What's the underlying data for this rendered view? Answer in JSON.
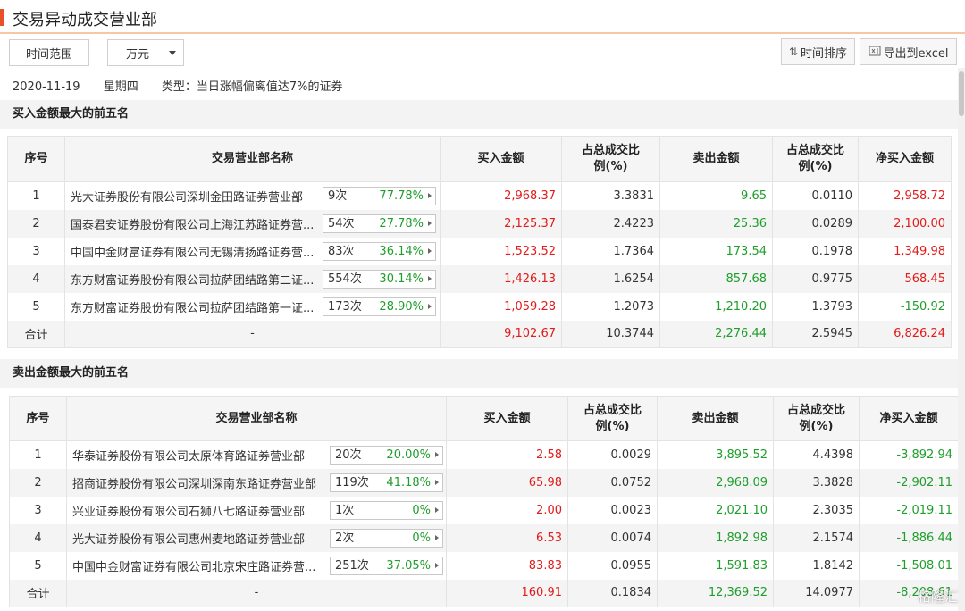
{
  "page": {
    "title": "交易异动成交营业部"
  },
  "toolbar": {
    "time_range": "时间范围",
    "unit": "万元",
    "sort_label": "时间排序",
    "export_label": "导出到excel"
  },
  "info": {
    "date": "2020-11-19",
    "weekday": "星期四",
    "type": "类型：当日涨幅偏离值达7%的证券"
  },
  "columns": [
    "序号",
    "交易营业部名称",
    "买入金额",
    "占总成交比例(%)",
    "卖出金额",
    "占总成交比例(%)",
    "净买入金额"
  ],
  "buy_section": {
    "title": "买入金额最大的前五名",
    "rows": [
      {
        "idx": "1",
        "name": "光大证券股份有限公司深圳金田路证券营业部",
        "count": "9次",
        "pct": "77.78%",
        "buy": "2,968.37",
        "buy_ratio": "3.3831",
        "sell": "9.65",
        "sell_ratio": "0.0110",
        "net": "2,958.72"
      },
      {
        "idx": "2",
        "name": "国泰君安证券股份有限公司上海江苏路证券营...",
        "count": "54次",
        "pct": "27.78%",
        "buy": "2,125.37",
        "buy_ratio": "2.4223",
        "sell": "25.36",
        "sell_ratio": "0.0289",
        "net": "2,100.00"
      },
      {
        "idx": "3",
        "name": "中国中金财富证券有限公司无锡清扬路证券营...",
        "count": "83次",
        "pct": "36.14%",
        "buy": "1,523.52",
        "buy_ratio": "1.7364",
        "sell": "173.54",
        "sell_ratio": "0.1978",
        "net": "1,349.98"
      },
      {
        "idx": "4",
        "name": "东方财富证券股份有限公司拉萨团结路第二证...",
        "count": "554次",
        "pct": "30.14%",
        "buy": "1,426.13",
        "buy_ratio": "1.6254",
        "sell": "857.68",
        "sell_ratio": "0.9775",
        "net": "568.45"
      },
      {
        "idx": "5",
        "name": "东方财富证券股份有限公司拉萨团结路第一证...",
        "count": "173次",
        "pct": "28.90%",
        "buy": "1,059.28",
        "buy_ratio": "1.2073",
        "sell": "1,210.20",
        "sell_ratio": "1.3793",
        "net": "-150.92"
      }
    ],
    "total": {
      "label": "合计",
      "name": "-",
      "buy": "9,102.67",
      "buy_ratio": "10.3744",
      "sell": "2,276.44",
      "sell_ratio": "2.5945",
      "net": "6,826.24"
    }
  },
  "sell_section": {
    "title": "卖出金额最大的前五名",
    "rows": [
      {
        "idx": "1",
        "name": "华泰证券股份有限公司太原体育路证券营业部",
        "count": "20次",
        "pct": "20.00%",
        "buy": "2.58",
        "buy_ratio": "0.0029",
        "sell": "3,895.52",
        "sell_ratio": "4.4398",
        "net": "-3,892.94"
      },
      {
        "idx": "2",
        "name": "招商证券股份有限公司深圳深南东路证券营业部",
        "count": "119次",
        "pct": "41.18%",
        "buy": "65.98",
        "buy_ratio": "0.0752",
        "sell": "2,968.09",
        "sell_ratio": "3.3828",
        "net": "-2,902.11"
      },
      {
        "idx": "3",
        "name": "兴业证券股份有限公司石狮八七路证券营业部",
        "count": "1次",
        "pct": "0%",
        "buy": "2.00",
        "buy_ratio": "0.0023",
        "sell": "2,021.10",
        "sell_ratio": "2.3035",
        "net": "-2,019.11"
      },
      {
        "idx": "4",
        "name": "光大证券股份有限公司惠州麦地路证券营业部",
        "count": "2次",
        "pct": "0%",
        "buy": "6.53",
        "buy_ratio": "0.0074",
        "sell": "1,892.98",
        "sell_ratio": "2.1574",
        "net": "-1,886.44"
      },
      {
        "idx": "5",
        "name": "中国中金财富证券有限公司北京宋庄路证券营...",
        "count": "251次",
        "pct": "37.05%",
        "buy": "83.83",
        "buy_ratio": "0.0955",
        "sell": "1,591.83",
        "sell_ratio": "1.8142",
        "net": "-1,508.01"
      }
    ],
    "total": {
      "label": "合计",
      "name": "-",
      "buy": "160.91",
      "buy_ratio": "0.1834",
      "sell": "12,369.52",
      "sell_ratio": "14.0977",
      "net": "-8,208.61"
    }
  },
  "watermark": "格隆汇",
  "colors": {
    "accent": "#e8502a",
    "up": "#e21b1b",
    "down": "#1f9e2c"
  }
}
